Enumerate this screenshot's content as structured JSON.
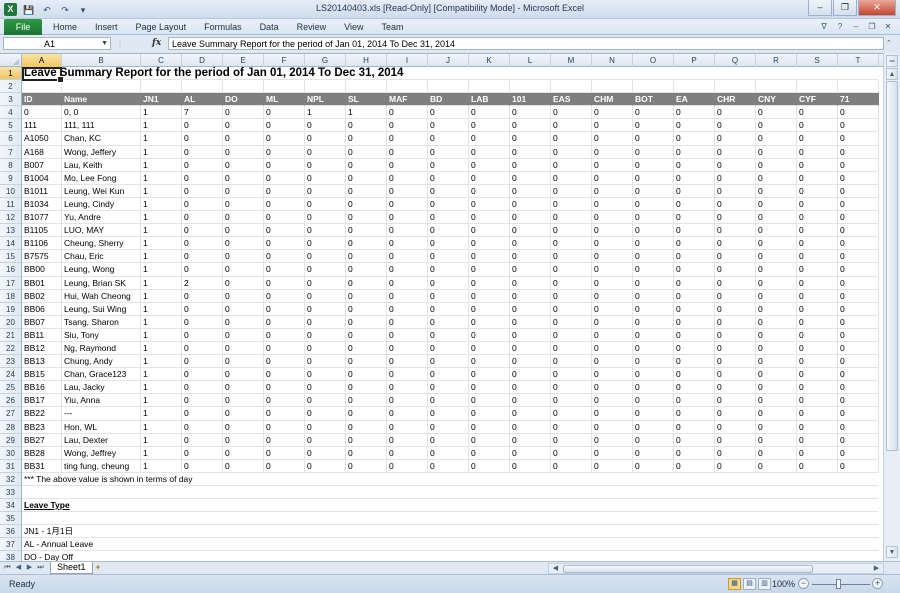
{
  "window": {
    "app_icon": "X",
    "title": "LS20140403.xls  [Read-Only]  [Compatibility Mode]  -  Microsoft Excel",
    "controls": [
      "–",
      "❐",
      "✕"
    ]
  },
  "qat": {
    "icons": [
      "save-icon",
      "undo-icon",
      "redo-icon",
      "customize-icon"
    ]
  },
  "ribbon": {
    "file_tab": "File",
    "tabs": [
      "Home",
      "Insert",
      "Page Layout",
      "Formulas",
      "Data",
      "Review",
      "View",
      "Team"
    ]
  },
  "formula_bar": {
    "name_box": "A1",
    "fx_label": "fx",
    "content": "Leave Summary Report for the period of  Jan 01, 2014 To Dec 31, 2014"
  },
  "sheet": {
    "columns": [
      "A",
      "B",
      "C",
      "D",
      "E",
      "F",
      "G",
      "H",
      "I",
      "J",
      "K",
      "L",
      "M",
      "N",
      "O",
      "P",
      "Q",
      "R",
      "S",
      "T"
    ],
    "selected_cell": "A1",
    "title": "Leave Summary Report for the period of  Jan 01, 2014 To Dec 31, 2014",
    "header": [
      "ID",
      "Name",
      "JN1",
      "AL",
      "DO",
      "ML",
      "NPL",
      "SL",
      "MAF",
      "BD",
      "LAB",
      "101",
      "EAS",
      "CHM",
      "BOT",
      "EA",
      "CHR",
      "CNY",
      "CYF",
      "71"
    ],
    "records": [
      [
        "0",
        "0, 0",
        "1",
        "7",
        "0",
        "0",
        "1",
        "1",
        "0",
        "0",
        "0",
        "0",
        "0",
        "0",
        "0",
        "0",
        "0",
        "0",
        "0",
        "0"
      ],
      [
        "111",
        "111, 111",
        "1",
        "0",
        "0",
        "0",
        "0",
        "0",
        "0",
        "0",
        "0",
        "0",
        "0",
        "0",
        "0",
        "0",
        "0",
        "0",
        "0",
        "0"
      ],
      [
        "A1050",
        "Chan, KC",
        "1",
        "0",
        "0",
        "0",
        "0",
        "0",
        "0",
        "0",
        "0",
        "0",
        "0",
        "0",
        "0",
        "0",
        "0",
        "0",
        "0",
        "0"
      ],
      [
        "A168",
        "Wong, Jeffery",
        "1",
        "0",
        "0",
        "0",
        "0",
        "0",
        "0",
        "0",
        "0",
        "0",
        "0",
        "0",
        "0",
        "0",
        "0",
        "0",
        "0",
        "0"
      ],
      [
        "B007",
        "Lau, Keith",
        "1",
        "0",
        "0",
        "0",
        "0",
        "0",
        "0",
        "0",
        "0",
        "0",
        "0",
        "0",
        "0",
        "0",
        "0",
        "0",
        "0",
        "0"
      ],
      [
        "B1004",
        "Mo, Lee Fong",
        "1",
        "0",
        "0",
        "0",
        "0",
        "0",
        "0",
        "0",
        "0",
        "0",
        "0",
        "0",
        "0",
        "0",
        "0",
        "0",
        "0",
        "0"
      ],
      [
        "B1011",
        "Leung, Wei Kun",
        "1",
        "0",
        "0",
        "0",
        "0",
        "0",
        "0",
        "0",
        "0",
        "0",
        "0",
        "0",
        "0",
        "0",
        "0",
        "0",
        "0",
        "0"
      ],
      [
        "B1034",
        "Leung, Cindy",
        "1",
        "0",
        "0",
        "0",
        "0",
        "0",
        "0",
        "0",
        "0",
        "0",
        "0",
        "0",
        "0",
        "0",
        "0",
        "0",
        "0",
        "0"
      ],
      [
        "B1077",
        "Yu, Andre",
        "1",
        "0",
        "0",
        "0",
        "0",
        "0",
        "0",
        "0",
        "0",
        "0",
        "0",
        "0",
        "0",
        "0",
        "0",
        "0",
        "0",
        "0"
      ],
      [
        "B1105",
        "LUO, MAY",
        "1",
        "0",
        "0",
        "0",
        "0",
        "0",
        "0",
        "0",
        "0",
        "0",
        "0",
        "0",
        "0",
        "0",
        "0",
        "0",
        "0",
        "0"
      ],
      [
        "B1106",
        "Cheung, Sherry",
        "1",
        "0",
        "0",
        "0",
        "0",
        "0",
        "0",
        "0",
        "0",
        "0",
        "0",
        "0",
        "0",
        "0",
        "0",
        "0",
        "0",
        "0"
      ],
      [
        "B7575",
        "Chau, Eric",
        "1",
        "0",
        "0",
        "0",
        "0",
        "0",
        "0",
        "0",
        "0",
        "0",
        "0",
        "0",
        "0",
        "0",
        "0",
        "0",
        "0",
        "0"
      ],
      [
        "BB00",
        "Leung, Wong",
        "1",
        "0",
        "0",
        "0",
        "0",
        "0",
        "0",
        "0",
        "0",
        "0",
        "0",
        "0",
        "0",
        "0",
        "0",
        "0",
        "0",
        "0"
      ],
      [
        "BB01",
        "Leung, Brian SK",
        "1",
        "2",
        "0",
        "0",
        "0",
        "0",
        "0",
        "0",
        "0",
        "0",
        "0",
        "0",
        "0",
        "0",
        "0",
        "0",
        "0",
        "0"
      ],
      [
        "BB02",
        "Hui, Wah Cheong",
        "1",
        "0",
        "0",
        "0",
        "0",
        "0",
        "0",
        "0",
        "0",
        "0",
        "0",
        "0",
        "0",
        "0",
        "0",
        "0",
        "0",
        "0"
      ],
      [
        "BB06",
        "Leung, Sui Wing",
        "1",
        "0",
        "0",
        "0",
        "0",
        "0",
        "0",
        "0",
        "0",
        "0",
        "0",
        "0",
        "0",
        "0",
        "0",
        "0",
        "0",
        "0"
      ],
      [
        "BB07",
        "Tsang, Sharon",
        "1",
        "0",
        "0",
        "0",
        "0",
        "0",
        "0",
        "0",
        "0",
        "0",
        "0",
        "0",
        "0",
        "0",
        "0",
        "0",
        "0",
        "0"
      ],
      [
        "BB11",
        "Siu, Tony",
        "1",
        "0",
        "0",
        "0",
        "0",
        "0",
        "0",
        "0",
        "0",
        "0",
        "0",
        "0",
        "0",
        "0",
        "0",
        "0",
        "0",
        "0"
      ],
      [
        "BB12",
        "Ng, Raymond",
        "1",
        "0",
        "0",
        "0",
        "0",
        "0",
        "0",
        "0",
        "0",
        "0",
        "0",
        "0",
        "0",
        "0",
        "0",
        "0",
        "0",
        "0"
      ],
      [
        "BB13",
        "Chung, Andy",
        "1",
        "0",
        "0",
        "0",
        "0",
        "0",
        "0",
        "0",
        "0",
        "0",
        "0",
        "0",
        "0",
        "0",
        "0",
        "0",
        "0",
        "0"
      ],
      [
        "BB15",
        "Chan, Grace123",
        "1",
        "0",
        "0",
        "0",
        "0",
        "0",
        "0",
        "0",
        "0",
        "0",
        "0",
        "0",
        "0",
        "0",
        "0",
        "0",
        "0",
        "0"
      ],
      [
        "BB16",
        "Lau, Jacky",
        "1",
        "0",
        "0",
        "0",
        "0",
        "0",
        "0",
        "0",
        "0",
        "0",
        "0",
        "0",
        "0",
        "0",
        "0",
        "0",
        "0",
        "0"
      ],
      [
        "BB17",
        "Yiu, Anna",
        "1",
        "0",
        "0",
        "0",
        "0",
        "0",
        "0",
        "0",
        "0",
        "0",
        "0",
        "0",
        "0",
        "0",
        "0",
        "0",
        "0",
        "0"
      ],
      [
        "BB22",
        "---",
        "1",
        "0",
        "0",
        "0",
        "0",
        "0",
        "0",
        "0",
        "0",
        "0",
        "0",
        "0",
        "0",
        "0",
        "0",
        "0",
        "0",
        "0"
      ],
      [
        "BB23",
        "Hon, WL",
        "1",
        "0",
        "0",
        "0",
        "0",
        "0",
        "0",
        "0",
        "0",
        "0",
        "0",
        "0",
        "0",
        "0",
        "0",
        "0",
        "0",
        "0"
      ],
      [
        "BB27",
        "Lau, Dexter",
        "1",
        "0",
        "0",
        "0",
        "0",
        "0",
        "0",
        "0",
        "0",
        "0",
        "0",
        "0",
        "0",
        "0",
        "0",
        "0",
        "0",
        "0"
      ],
      [
        "BB28",
        "Wong, Jeffrey",
        "1",
        "0",
        "0",
        "0",
        "0",
        "0",
        "0",
        "0",
        "0",
        "0",
        "0",
        "0",
        "0",
        "0",
        "0",
        "0",
        "0",
        "0"
      ],
      [
        "BB31",
        "ting fung, cheung",
        "1",
        "0",
        "0",
        "0",
        "0",
        "0",
        "0",
        "0",
        "0",
        "0",
        "0",
        "0",
        "0",
        "0",
        "0",
        "0",
        "0",
        "0"
      ]
    ],
    "note": "*** The above value is shown in terms of day",
    "leave_type_heading": "Leave Type",
    "leave_types": [
      "JN1 - 1月1日",
      "AL - Annual Leave",
      "DO - Day Off"
    ]
  },
  "sheet_tabs": {
    "active": "Sheet1"
  },
  "status": {
    "ready": "Ready",
    "zoom": "100%"
  }
}
